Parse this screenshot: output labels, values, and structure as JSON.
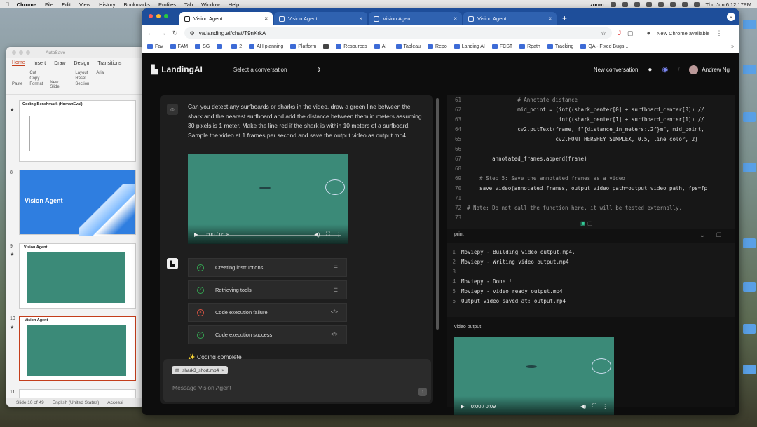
{
  "menubar": {
    "app": "Chrome",
    "items": [
      "File",
      "Edit",
      "View",
      "History",
      "Bookmarks",
      "Profiles",
      "Tab",
      "Window",
      "Help"
    ],
    "status_app": "zoom",
    "clock": "Thu Jun 6  12:17PM"
  },
  "ppt": {
    "autosave": "AutoSave",
    "tabs": [
      "Home",
      "Insert",
      "Draw",
      "Design",
      "Transitions"
    ],
    "ribbon": [
      "Paste",
      "Cut",
      "Copy",
      "Format",
      "New Slide",
      "Layout",
      "Reset",
      "Section"
    ],
    "font": "Arial",
    "slides": [
      {
        "num": "",
        "title": "Coding Benchmark (HumanEval)"
      },
      {
        "num": "8",
        "title": "Vision Agent"
      },
      {
        "num": "9",
        "title": "Vision Agent"
      },
      {
        "num": "10",
        "title": "Vision Agent"
      },
      {
        "num": "11",
        "title": ""
      }
    ],
    "status_slide": "Slide 10 of 49",
    "status_lang": "English (United States)",
    "status_acc": "Accessi"
  },
  "chrome": {
    "tabs": [
      "Vision Agent",
      "Vision Agent",
      "Vision Agent",
      "Vision Agent"
    ],
    "url": "va.landing.ai/chat/T9nKrkA",
    "update": "New Chrome available",
    "bookmarks": [
      "Fav",
      "FAM",
      "SG",
      "",
      "2",
      "AH planning",
      "Platform",
      "",
      "Resources",
      "AH",
      "Tableau",
      "Repo",
      "Landing AI",
      "FCST",
      "Rpath",
      "Tracking",
      "QA - Fixed Bugs..."
    ]
  },
  "app": {
    "logo": "LandingAI",
    "select": "Select a conversation",
    "new_conv": "New conversation",
    "user": "Andrew Ng",
    "prompt": "Can you detect any surfboards or sharks in the video, draw a green line between the shark and the nearest surfboard and add the distance between them in meters assuming 30 pixels is 1 meter. Make the line red if the shark is within 10 meters of a surfboard. Sample the video at 1 frames per second and save the output video as output.mp4.",
    "video_time": "0:00 / 0:08",
    "steps": [
      {
        "label": "Creating instructions",
        "status": "success"
      },
      {
        "label": "Retrieving tools",
        "status": "success"
      },
      {
        "label": "Code execution failure",
        "status": "failure"
      },
      {
        "label": "Code execution success",
        "status": "success"
      }
    ],
    "coding_complete": "Coding complete",
    "attachment": "shark3_short.mp4",
    "placeholder": "Message Vision Agent",
    "code_lines": [
      {
        "n": "61",
        "t": "                # Annotate distance"
      },
      {
        "n": "62",
        "t": "                mid_point = (int((shark_center[0] + surfboard_center[0]) //"
      },
      {
        "n": "63",
        "t": "                             int((shark_center[1] + surfboard_center[1]) //"
      },
      {
        "n": "64",
        "t": "                cv2.putText(frame, f\"{distance_in_meters:.2f}m\", mid_point,"
      },
      {
        "n": "65",
        "t": "                            cv2.FONT_HERSHEY_SIMPLEX, 0.5, line_color, 2)"
      },
      {
        "n": "66",
        "t": ""
      },
      {
        "n": "67",
        "t": "        annotated_frames.append(frame)"
      },
      {
        "n": "68",
        "t": ""
      },
      {
        "n": "69",
        "t": "    # Step 5: Save the annotated frames as a video"
      },
      {
        "n": "70",
        "t": "    save_video(annotated_frames, output_video_path=output_video_path, fps=fp"
      },
      {
        "n": "71",
        "t": ""
      },
      {
        "n": "72",
        "t": "# Note: Do not call the function here. it will be tested externally."
      },
      {
        "n": "73",
        "t": ""
      }
    ],
    "print_label": "print",
    "print_lines": [
      {
        "n": "1",
        "t": "Moviepy - Building video output.mp4."
      },
      {
        "n": "2",
        "t": "Moviepy - Writing video output.mp4"
      },
      {
        "n": "3",
        "t": ""
      },
      {
        "n": "4",
        "t": "Moviepy - Done !"
      },
      {
        "n": "5",
        "t": "Moviepy - video ready output.mp4"
      },
      {
        "n": "6",
        "t": "Output video saved at: output.mp4"
      }
    ],
    "video_output_label": "video output",
    "output_video_time": "0:00 / 0:09"
  }
}
